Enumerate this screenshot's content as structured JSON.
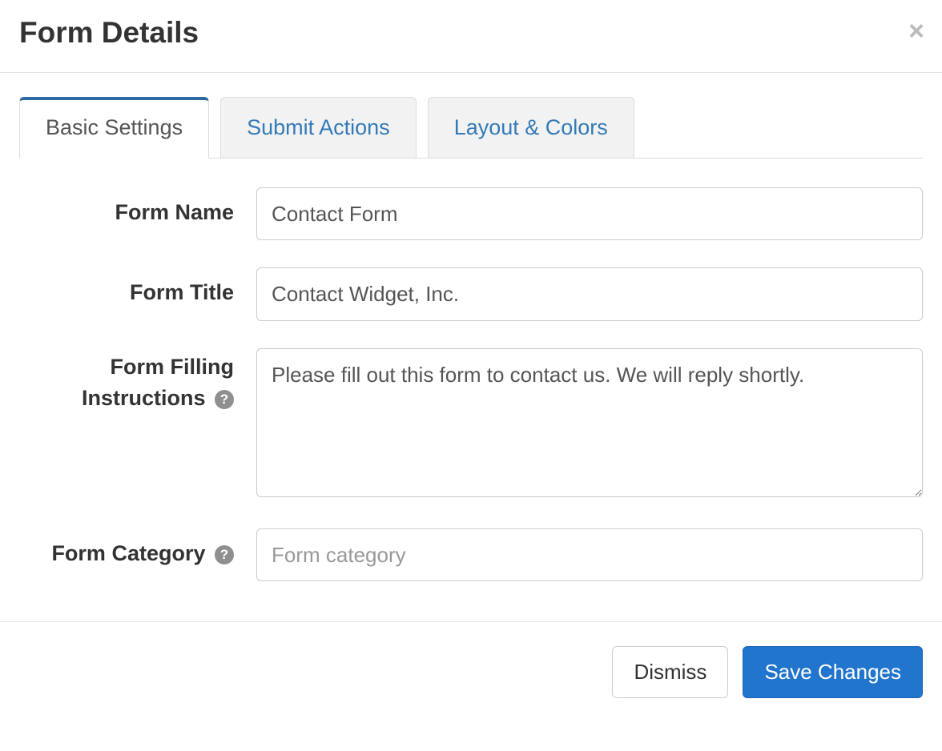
{
  "header": {
    "title": "Form Details"
  },
  "tabs": [
    {
      "label": "Basic Settings",
      "active": true
    },
    {
      "label": "Submit Actions",
      "active": false
    },
    {
      "label": "Layout & Colors",
      "active": false
    }
  ],
  "fields": {
    "form_name": {
      "label": "Form Name",
      "value": "Contact Form"
    },
    "form_title": {
      "label": "Form Title",
      "value": "Contact Widget, Inc."
    },
    "form_instructions": {
      "label_line1": "Form Filling",
      "label_line2": "Instructions",
      "value": "Please fill out this form to contact us. We will reply shortly."
    },
    "form_category": {
      "label": "Form Category",
      "value": "",
      "placeholder": "Form category"
    }
  },
  "footer": {
    "dismiss": "Dismiss",
    "save": "Save Changes"
  }
}
